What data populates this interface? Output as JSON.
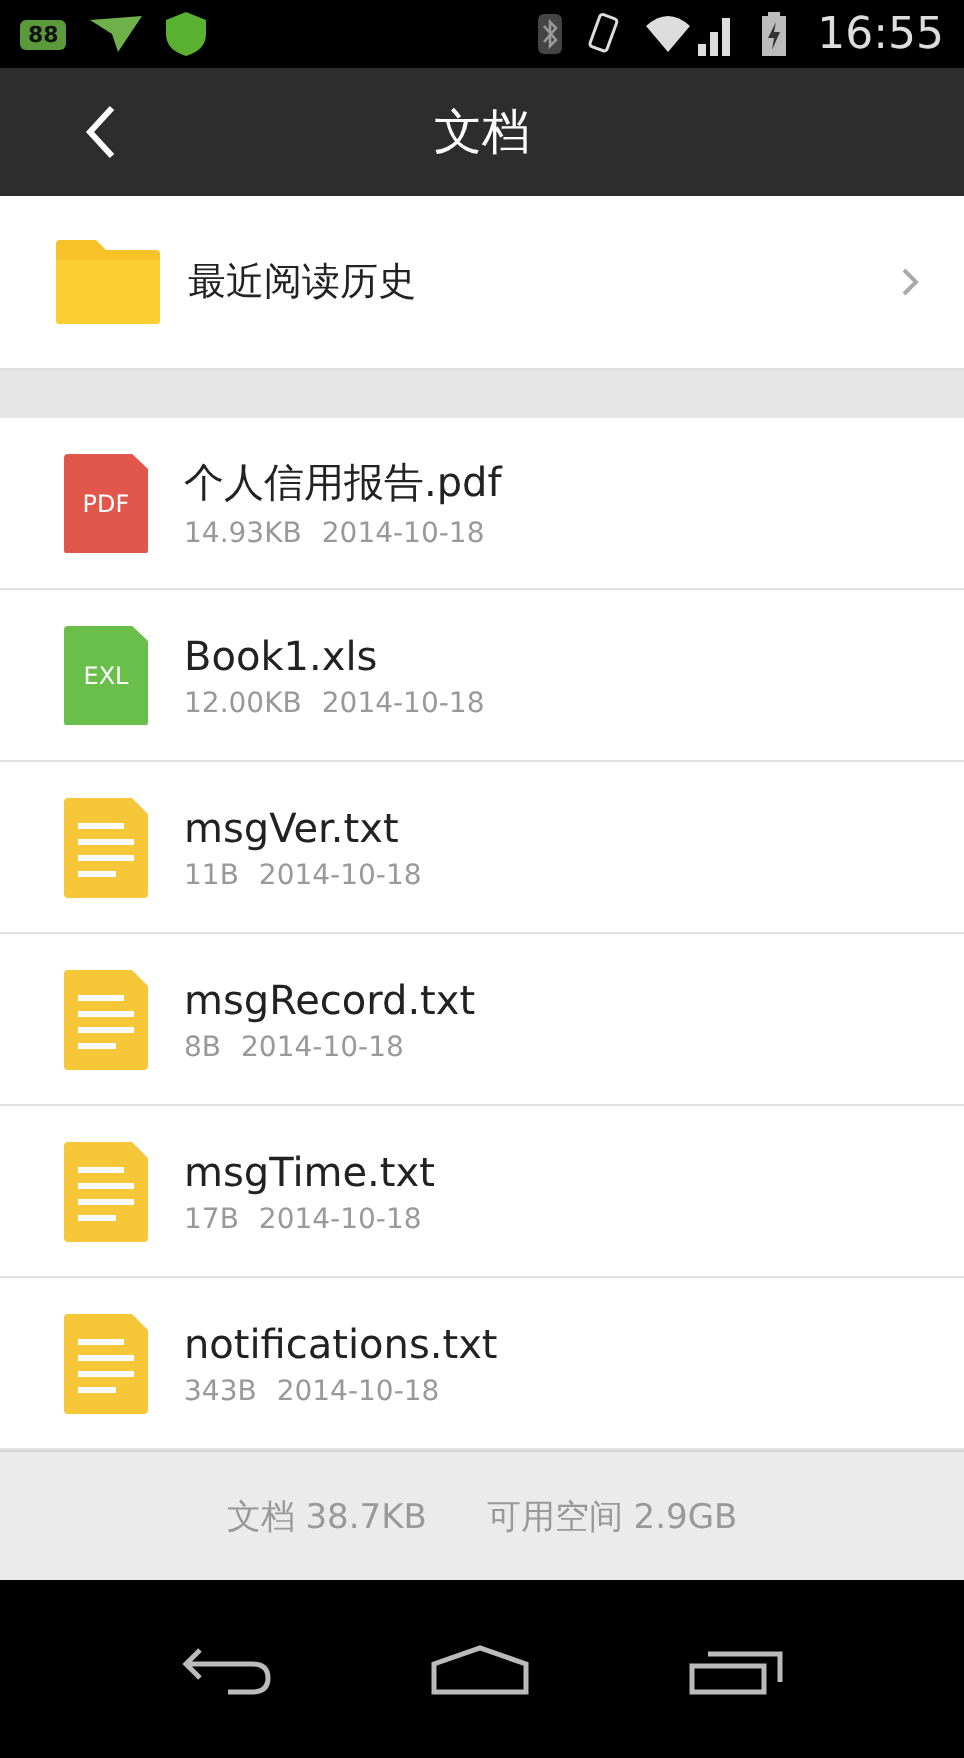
{
  "status_bar": {
    "battery_badge": "88",
    "time": "16:55"
  },
  "header": {
    "title": "文档"
  },
  "recent": {
    "label": "最近阅读历史"
  },
  "files": [
    {
      "kind": "pdf",
      "icon_label": "PDF",
      "name": "个人信用报告.pdf",
      "size": "14.93KB",
      "date": "2014-10-18"
    },
    {
      "kind": "xls",
      "icon_label": "EXL",
      "name": "Book1.xls",
      "size": "12.00KB",
      "date": "2014-10-18"
    },
    {
      "kind": "txt",
      "name": "msgVer.txt",
      "size": "11B",
      "date": "2014-10-18"
    },
    {
      "kind": "txt",
      "name": "msgRecord.txt",
      "size": "8B",
      "date": "2014-10-18"
    },
    {
      "kind": "txt",
      "name": "msgTime.txt",
      "size": "17B",
      "date": "2014-10-18"
    },
    {
      "kind": "txt",
      "name": "notifications.txt",
      "size": "343B",
      "date": "2014-10-18"
    }
  ],
  "footer": {
    "documents": "文档 38.7KB",
    "free_space": "可用空间 2.9GB"
  }
}
